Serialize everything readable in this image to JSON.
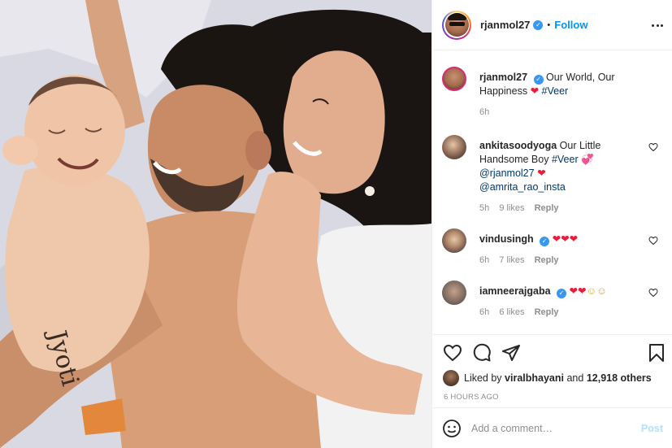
{
  "post": {
    "author": "rjanmol27",
    "follow_label": "Follow",
    "dot": "•"
  },
  "caption": {
    "username": "rjanmol27",
    "text": "Our World, Our Happiness",
    "heart": "❤",
    "hashtag": "#Veer",
    "time": "6h"
  },
  "comments": [
    {
      "username": "ankitasoodyoga",
      "text": "Our Little Handsome Boy",
      "hashtag": "#Veer",
      "emoji": "💞",
      "mention": "@rjanmol27",
      "emoji2": "❤",
      "mention2": "@amrita_rao_insta",
      "time": "5h",
      "likes": "9 likes",
      "reply": "Reply"
    },
    {
      "username": "vindusingh",
      "emojis": "❤❤❤",
      "time": "6h",
      "likes": "7 likes",
      "reply": "Reply"
    },
    {
      "username": "iamneerajgaba",
      "emojis_hearts": "❤❤",
      "emojis_smiles": "☺☺",
      "time": "6h",
      "likes": "6 likes",
      "reply": "Reply"
    }
  ],
  "likes": {
    "prefix": "Liked by",
    "user": "viralbhayani",
    "and": "and",
    "others": "12,918 others"
  },
  "timestamp": "6 HOURS AGO",
  "add_comment": {
    "placeholder": "Add a comment…",
    "post_label": "Post"
  },
  "photo": {
    "tattoo_text": "Jyoti"
  },
  "colors": {
    "link": "#00376b",
    "follow": "#0095f6",
    "verified": "#3897f0",
    "heart": "#ed1b3a",
    "muted": "#8e8e8e"
  }
}
